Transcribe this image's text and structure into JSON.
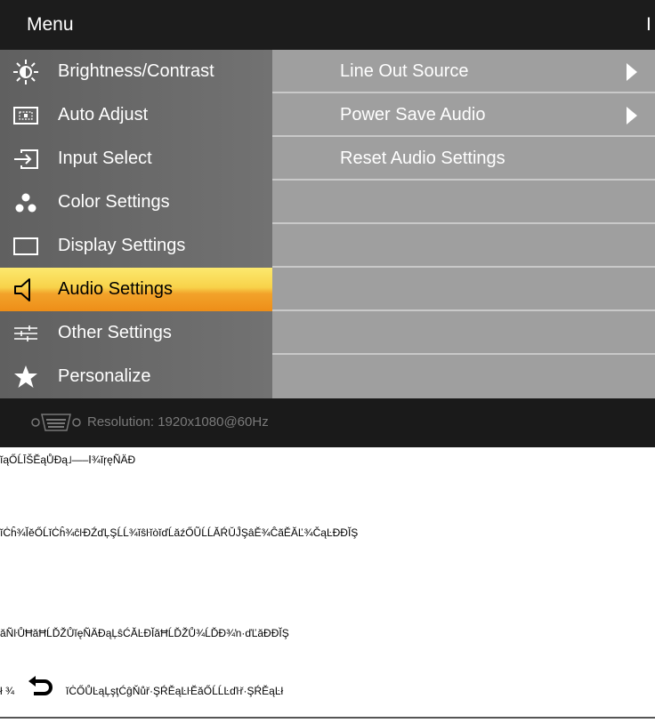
{
  "menu": {
    "title": "Menu",
    "header_edge": "I",
    "items": [
      {
        "label": "Brightness/Contrast",
        "icon": "brightness-icon"
      },
      {
        "label": "Auto Adjust",
        "icon": "auto-adjust-icon"
      },
      {
        "label": "Input Select",
        "icon": "input-select-icon"
      },
      {
        "label": "Color Settings",
        "icon": "color-settings-icon"
      },
      {
        "label": "Display Settings",
        "icon": "display-settings-icon"
      },
      {
        "label": "Audio Settings",
        "icon": "speaker-icon",
        "active": true
      },
      {
        "label": "Other Settings",
        "icon": "other-settings-icon"
      },
      {
        "label": "Personalize",
        "icon": "star-icon"
      }
    ]
  },
  "submenu": {
    "items": [
      {
        "label": "Line Out Source",
        "has_arrow": true
      },
      {
        "label": "Power Save Audio",
        "has_arrow": true
      },
      {
        "label": "Reset Audio Settings",
        "has_arrow": false
      },
      {
        "label": ""
      },
      {
        "label": ""
      },
      {
        "label": ""
      },
      {
        "label": ""
      },
      {
        "label": ""
      }
    ]
  },
  "status": {
    "resolution": "Resolution:  1920x1080@60Hz",
    "icon": "vga-connector-icon"
  },
  "doc": {
    "line1": "ĭąŐĹĪŠĔąŮĐą˩—–Ⅰ¾ĭŗęÑÄĐ",
    "line2": "ĭĊĥ¾ĬĕŐĹĭĊĥ¾ĉŀĐŹďĻŞĹĹ¾ĭŝŀĭòĭďĹăźŐŨĹĹĂŔŬĴŞâĚ¾ĈãĚĂĽ¾ČąĿĐĐĬŞ",
    "line3": "ăÑŀŮĦăĦĹĎŽŮĭęÑÄĐąĻŝĆĂĿĐĬăĦĹĎŽŮ¾ĹĎĐ¾ŉ·ďĽăĐĐĬŞ",
    "line4_prefix": "ł ¾",
    "line4": "ĭĊŐŮĿąĻşţĆĝŇůř·ŞŔĚąĿŀĔăŐĹĹĿďŀř·ŞŔĚąĿł",
    "back_icon": "back-arrow-icon"
  },
  "colors": {
    "header_bg": "#1c1c1c",
    "left_panel": "#686868",
    "right_panel": "#9f9f9f",
    "active_top": "#fce96e",
    "active_bottom": "#ee8e18"
  }
}
